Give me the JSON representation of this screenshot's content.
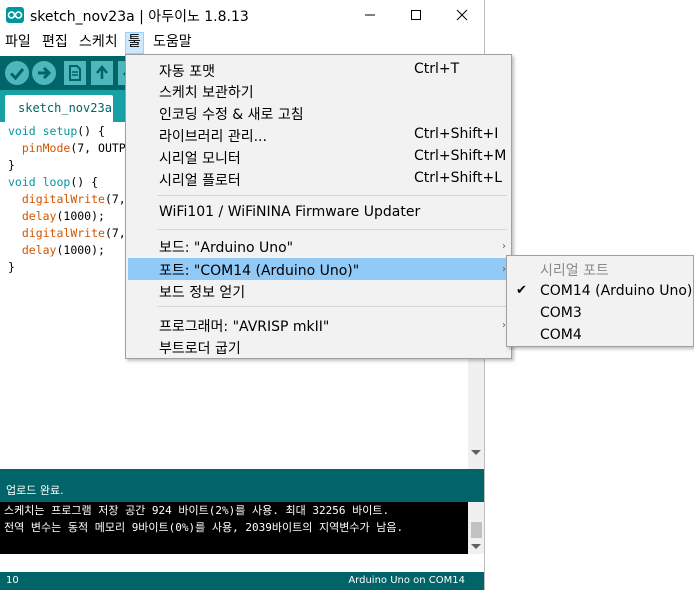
{
  "window": {
    "title": "sketch_nov23a | 아두이노 1.8.13"
  },
  "menubar": [
    {
      "label": "파일"
    },
    {
      "label": "편집"
    },
    {
      "label": "스케치"
    },
    {
      "label": "툴"
    },
    {
      "label": "도움말"
    }
  ],
  "toolbar": {
    "buttons": [
      "verify-icon",
      "upload-icon",
      "new-icon",
      "open-icon",
      "save-icon"
    ]
  },
  "tab": {
    "active_label": "sketch_nov23a"
  },
  "code": [
    {
      "t1": "void ",
      "t2": "setup",
      "t3": "() {"
    },
    {
      "t1": "  ",
      "t2": "pinMode",
      "t3": "(7, OUTP"
    },
    {
      "t1": "}",
      "t2": "",
      "t3": ""
    },
    {
      "t1": "void ",
      "t2": "loop",
      "t3": "() {"
    },
    {
      "t1": "  ",
      "t2": "digitalWrite",
      "t3": "(7,"
    },
    {
      "t1": "  ",
      "t2": "delay",
      "t3": "(1000);"
    },
    {
      "t1": "  ",
      "t2": "digitalWrite",
      "t3": "(7,"
    },
    {
      "t1": "  ",
      "t2": "delay",
      "t3": "(1000);"
    },
    {
      "t1": "}",
      "t2": "",
      "t3": ""
    }
  ],
  "status": {
    "message": "업로드 완료."
  },
  "console": {
    "lines": [
      "스케치는 프로그램 저장 공간 924 바이트(2%)를 사용. 최대 32256 바이트.",
      "전역 변수는 동적 메모리 9바이트(0%)를 사용, 2039바이트의 지역변수가 남음."
    ]
  },
  "footer": {
    "line_number": "10",
    "board": "Arduino Uno on COM14"
  },
  "tools_menu": {
    "items": [
      {
        "label": "자동 포맷",
        "shortcut": "Ctrl+T"
      },
      {
        "label": "스케치 보관하기",
        "shortcut": ""
      },
      {
        "label": "인코딩 수정 & 새로 고침",
        "shortcut": ""
      },
      {
        "label": "라이브러리 관리...",
        "shortcut": "Ctrl+Shift+I"
      },
      {
        "label": "시리얼 모니터",
        "shortcut": "Ctrl+Shift+M"
      },
      {
        "label": "시리얼 플로터",
        "shortcut": "Ctrl+Shift+L"
      },
      {
        "label": "WiFi101 / WiFiNINA Firmware Updater",
        "shortcut": ""
      },
      {
        "label": "보드: \"Arduino Uno\"",
        "shortcut": ""
      },
      {
        "label": "포트: \"COM14 (Arduino Uno)\"",
        "shortcut": ""
      },
      {
        "label": "보드 정보 얻기",
        "shortcut": ""
      },
      {
        "label": "프로그래머: \"AVRISP mkII\"",
        "shortcut": ""
      },
      {
        "label": "부트로더 굽기",
        "shortcut": ""
      }
    ]
  },
  "port_submenu": {
    "header": "시리얼 포트",
    "items": [
      {
        "label": "COM14 (Arduino Uno)",
        "checked": true
      },
      {
        "label": "COM3",
        "checked": false
      },
      {
        "label": "COM4",
        "checked": false
      }
    ]
  },
  "colors": {
    "teal_dark": "#006468",
    "teal_tab": "#17a1a5",
    "toolbar_button": "#4db7bb",
    "menu_highlight": "#91c9f7",
    "keyword": "#00979c",
    "function": "#d35400"
  }
}
